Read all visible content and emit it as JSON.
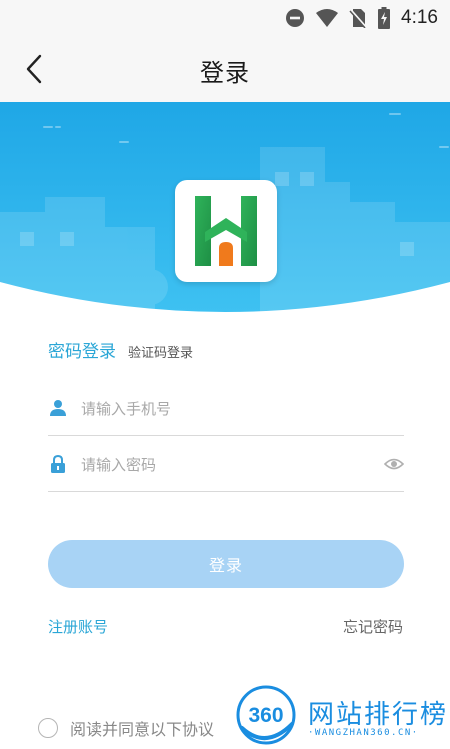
{
  "status_bar": {
    "time": "4:16",
    "icons": [
      "do-not-disturb-icon",
      "wifi-icon",
      "no-sim-icon",
      "battery-charging-icon"
    ]
  },
  "app_bar": {
    "title": "登录",
    "back_icon": "chevron-left-icon"
  },
  "banner": {
    "logo_icon": "app-logo-h",
    "colors": {
      "sky_top": "#1fa7e6",
      "sky_bottom": "#3fc2f2",
      "logo_green": "#2fb35a",
      "logo_orange": "#f07a1c"
    }
  },
  "tabs": {
    "password_login": "密码登录",
    "code_login": "验证码登录"
  },
  "form": {
    "phone_placeholder": "请输入手机号",
    "phone_icon": "user-icon",
    "password_placeholder": "请输入密码",
    "password_icon": "lock-icon",
    "visibility_icon": "eye-icon",
    "login_button": "登录"
  },
  "links": {
    "register": "注册账号",
    "forgot_password": "忘记密码"
  },
  "agreement": {
    "text": "阅读并同意以下协议"
  },
  "watermark": {
    "badge": "360",
    "brand": "网站排行榜",
    "domain": "·WANGZHAN360.CN·"
  },
  "colors": {
    "accent": "#2aa6d6",
    "button_disabled": "#a8d3f5",
    "background_bar": "#f7f7f7"
  }
}
